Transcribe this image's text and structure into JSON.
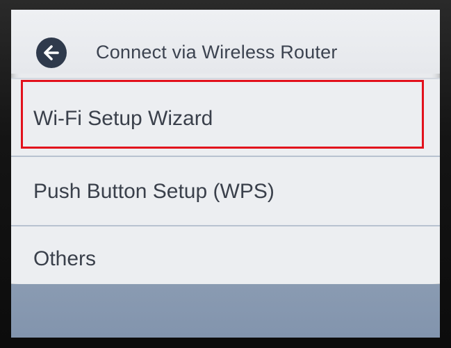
{
  "header": {
    "title": "Connect via Wireless Router",
    "back_icon": "arrow-left-icon"
  },
  "menu": {
    "items": [
      {
        "label": "Wi-Fi Setup Wizard",
        "selected": true
      },
      {
        "label": "Push Button Setup (WPS)",
        "selected": false
      },
      {
        "label": "Others",
        "selected": false
      }
    ]
  },
  "colors": {
    "screen_bg": "#e9ebee",
    "text": "#3a404b",
    "back_button": "#2f3a4c",
    "highlight": "#e2111c",
    "divider": "#b8c2d0",
    "footer_band": "#8a9bb2"
  }
}
